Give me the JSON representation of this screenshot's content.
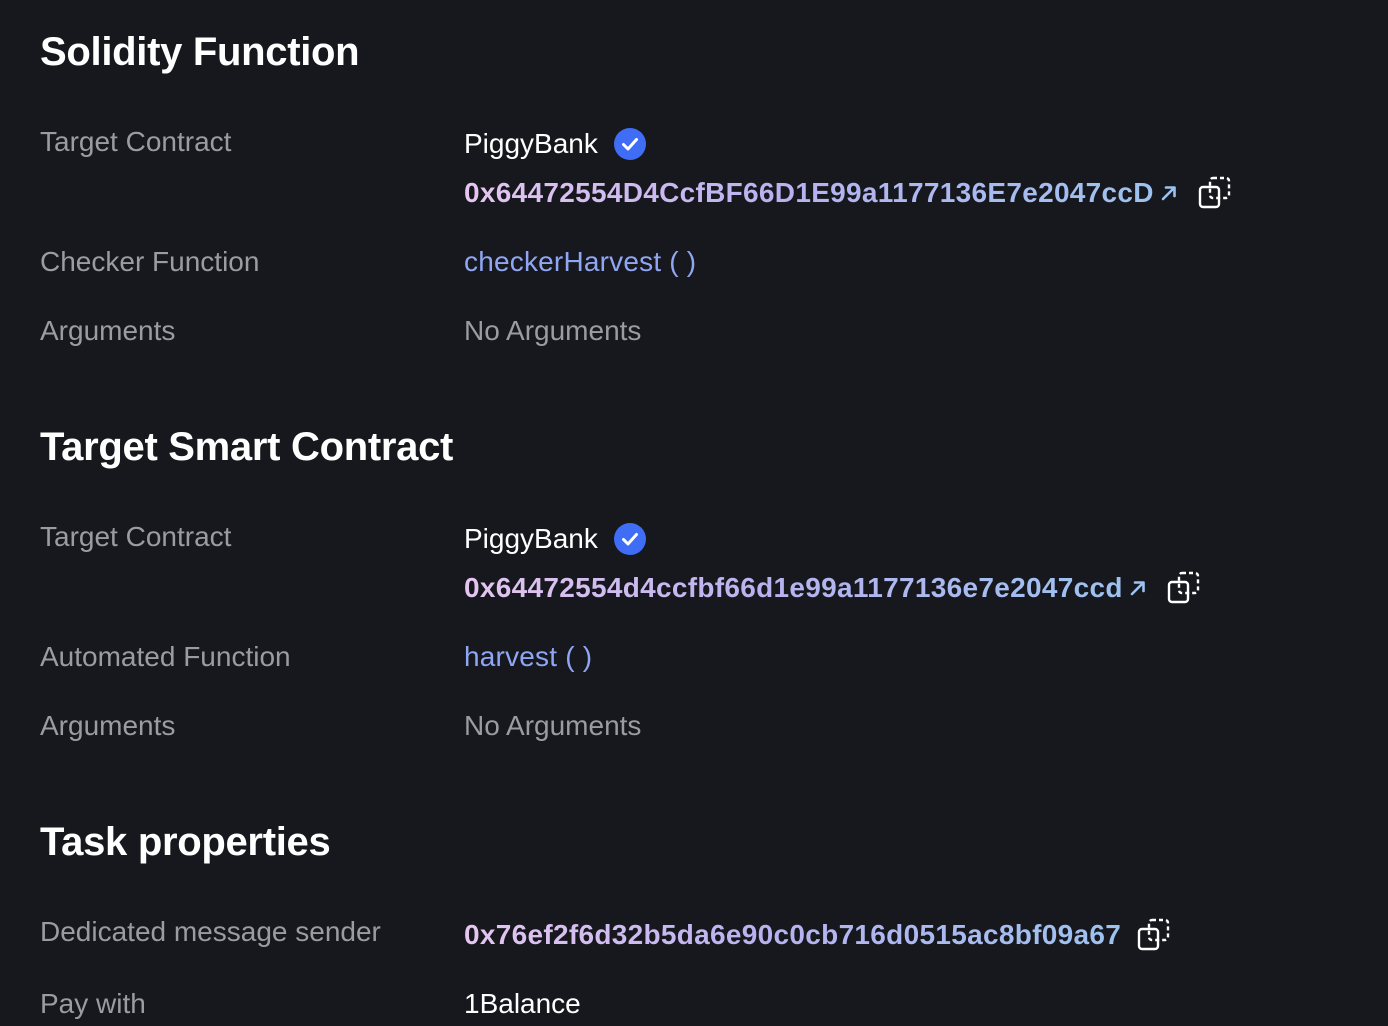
{
  "solidity_function": {
    "title": "Solidity Function",
    "target_contract_label": "Target Contract",
    "contract_name": "PiggyBank",
    "contract_address": "0x64472554D4CcfBF66D1E99a1177136E7e2047ccD",
    "checker_function_label": "Checker Function",
    "checker_function": "checkerHarvest ( )",
    "arguments_label": "Arguments",
    "arguments_value": "No Arguments"
  },
  "target_smart_contract": {
    "title": "Target Smart Contract",
    "target_contract_label": "Target Contract",
    "contract_name": "PiggyBank",
    "contract_address": "0x64472554d4ccfbf66d1e99a1177136e7e2047ccd",
    "automated_function_label": "Automated Function",
    "automated_function": "harvest ( )",
    "arguments_label": "Arguments",
    "arguments_value": "No Arguments"
  },
  "task_properties": {
    "title": "Task properties",
    "sender_label": "Dedicated message sender",
    "sender_address": "0x76ef2f6d32b5da6e90c0cb716d0515ac8bf09a67",
    "pay_with_label": "Pay with",
    "pay_with_value": "1Balance"
  },
  "colors": {
    "background": "#17181d",
    "label": "#9a9ca4",
    "link": "#8fa6f5",
    "verified": "#3f6df6"
  }
}
